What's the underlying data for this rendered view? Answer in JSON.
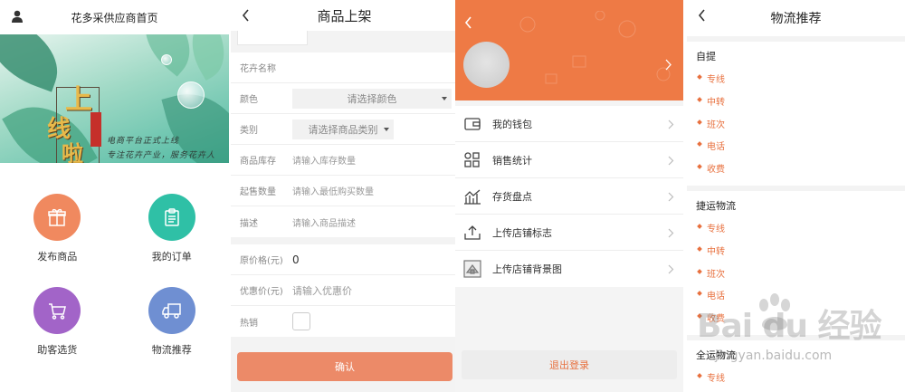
{
  "home": {
    "title": "花多采供应商首页",
    "banner": {
      "headline": "上线啦",
      "tagline1": "电商平台正式上线",
      "tagline2": "专注花卉产业，服务花卉人",
      "seal": "花多采"
    },
    "tiles": [
      {
        "label": "发布商品",
        "icon": "gift-icon",
        "color": "#f0895f"
      },
      {
        "label": "我的订单",
        "icon": "clipboard-icon",
        "color": "#2fc0a6"
      },
      {
        "label": "助客选货",
        "icon": "cart-icon",
        "color": "#a264c8"
      },
      {
        "label": "物流推荐",
        "icon": "truck-icon",
        "color": "#6f8fd2"
      }
    ]
  },
  "listing": {
    "title": "商品上架",
    "fields": {
      "name": {
        "label": "花卉名称"
      },
      "color": {
        "label": "颜色",
        "value": "请选择颜色"
      },
      "category": {
        "label": "类别",
        "value": "请选择商品类别"
      },
      "stock": {
        "label": "商品库存",
        "placeholder": "请输入库存数量"
      },
      "min_qty": {
        "label": "起售数量",
        "placeholder": "请输入最低购买数量"
      },
      "desc": {
        "label": "描述",
        "placeholder": "请输入商品描述"
      },
      "price": {
        "label": "原价格(元)",
        "value": "0"
      },
      "discount": {
        "label": "优惠价(元)",
        "placeholder": "请输入优惠价"
      },
      "hot": {
        "label": "热销"
      }
    },
    "confirm_label": "确认",
    "accent": "#ec8a68"
  },
  "profile": {
    "header_color": "#ee7a45",
    "menu": [
      {
        "label": "我的钱包",
        "icon": "wallet-icon"
      },
      {
        "label": "销售统计",
        "icon": "grid-icon"
      },
      {
        "label": "存货盘点",
        "icon": "chart-icon"
      },
      {
        "label": "上传店铺标志",
        "icon": "upload-icon"
      },
      {
        "label": "上传店铺背景图",
        "icon": "image-icon"
      }
    ],
    "logout_label": "退出登录"
  },
  "logistics": {
    "title": "物流推荐",
    "sections": [
      {
        "title": "自提",
        "options": [
          "专线",
          "中转",
          "班次",
          "电话",
          "收费"
        ]
      },
      {
        "title": "捷运物流",
        "options": [
          "专线",
          "中转",
          "班次",
          "电话",
          "收费"
        ]
      },
      {
        "title": "全运物流",
        "options": [
          "专线"
        ]
      }
    ]
  },
  "watermark": {
    "brand": "Bai du 经验",
    "url": "jingyan.baidu.com"
  }
}
